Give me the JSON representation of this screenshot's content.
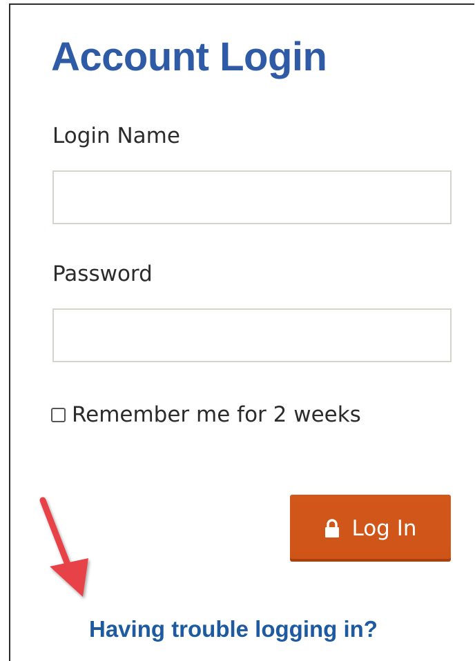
{
  "colors": {
    "title": "#2f5ba6",
    "text": "#2b2b2b",
    "input_border": "#d5d4c9",
    "button_background": "#d2571b",
    "button_text": "#ffffff",
    "link": "#1d5aa0",
    "annotation_arrow": "#e8424a"
  },
  "page": {
    "title": "Account Login"
  },
  "form": {
    "login_name_label": "Login Name",
    "login_name_value": "",
    "password_label": "Password",
    "password_value": "",
    "remember_label": "Remember me for 2 weeks",
    "remember_checked": false,
    "submit_label": "Log In",
    "submit_icon": "lock-icon"
  },
  "help": {
    "link_text": "Having trouble logging in?"
  },
  "annotation": {
    "icon": "red-arrow-icon",
    "points_to": "help-link"
  }
}
